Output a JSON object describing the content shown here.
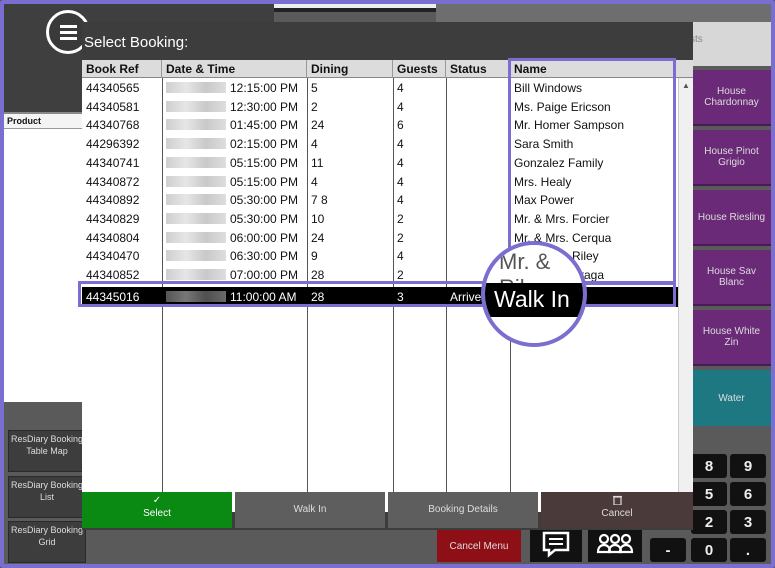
{
  "dialog": {
    "title": "Select Booking:",
    "columns": [
      "Book Ref",
      "Date & Time",
      "Dining",
      "Guests",
      "Status",
      "Name"
    ],
    "rows": [
      {
        "ref": "44340565",
        "time": "12:15:00 PM",
        "dining": "5",
        "guests": "4",
        "status": "",
        "name": "Bill Windows"
      },
      {
        "ref": "44340581",
        "time": "12:30:00 PM",
        "dining": "2",
        "guests": "4",
        "status": "",
        "name": "Ms. Paige Ericson"
      },
      {
        "ref": "44340768",
        "time": "01:45:00 PM",
        "dining": "24",
        "guests": "6",
        "status": "",
        "name": "Mr. Homer Sampson"
      },
      {
        "ref": "44296392",
        "time": "02:15:00 PM",
        "dining": "4",
        "guests": "4",
        "status": "",
        "name": "Sara Smith"
      },
      {
        "ref": "44340741",
        "time": "05:15:00 PM",
        "dining": "11",
        "guests": "4",
        "status": "",
        "name": "Gonzalez Family"
      },
      {
        "ref": "44340872",
        "time": "05:15:00 PM",
        "dining": "4",
        "guests": "4",
        "status": "",
        "name": "Mrs. Healy"
      },
      {
        "ref": "44340892",
        "time": "05:30:00 PM",
        "dining": "7 8",
        "guests": "4",
        "status": "",
        "name": "Max Power"
      },
      {
        "ref": "44340829",
        "time": "05:30:00 PM",
        "dining": "10",
        "guests": "2",
        "status": "",
        "name": "Mr. & Mrs. Forcier"
      },
      {
        "ref": "44340804",
        "time": "06:00:00 PM",
        "dining": "24",
        "guests": "2",
        "status": "",
        "name": "Mr. & Mrs. Cerqua"
      },
      {
        "ref": "44340470",
        "time": "06:30:00 PM",
        "dining": "9",
        "guests": "4",
        "status": "",
        "name": "Mr. & Mrs. Riley"
      },
      {
        "ref": "44340852",
        "time": "07:00:00 PM",
        "dining": "28",
        "guests": "2",
        "status": "",
        "name": "Mr. & Mrs. Braga"
      }
    ],
    "selected_row": {
      "ref": "44345016",
      "time": "11:00:00 AM",
      "dining": "28",
      "guests": "3",
      "status": "Arrive",
      "name": "Walk In"
    },
    "buttons": {
      "select": "Select",
      "walk_in": "Walk In",
      "booking_details": "Booking Details",
      "cancel": "Cancel"
    }
  },
  "magnifier": {
    "top_text": "Mr. & Riley",
    "zoom_text": "Walk In"
  },
  "background": {
    "top_right_label": "sts",
    "product_header": "Product",
    "side_buttons": [
      {
        "label": "ResDiary Booking Table Map"
      },
      {
        "label": "ResDiary Booking List"
      },
      {
        "label": "ResDiary Booking Grid"
      }
    ],
    "product_tiles": [
      {
        "label": "House Chardonnay"
      },
      {
        "label": "House Pinot Grigio"
      },
      {
        "label": "House Riesling"
      },
      {
        "label": "House Sav Blanc"
      },
      {
        "label": "House White Zin"
      },
      {
        "label": "Water"
      }
    ],
    "keypad": [
      "8",
      "9",
      "5",
      "6",
      "2",
      "3",
      "0",
      "."
    ],
    "keypad_minus": "-",
    "cancel_menu": "Cancel Menu"
  },
  "colors": {
    "highlight": "#7a6ed0",
    "select_button": "#0a8a12",
    "cancel_menu": "#8e0f16",
    "product_tile": "#6a2a78",
    "water_tile": "#1d7882"
  }
}
